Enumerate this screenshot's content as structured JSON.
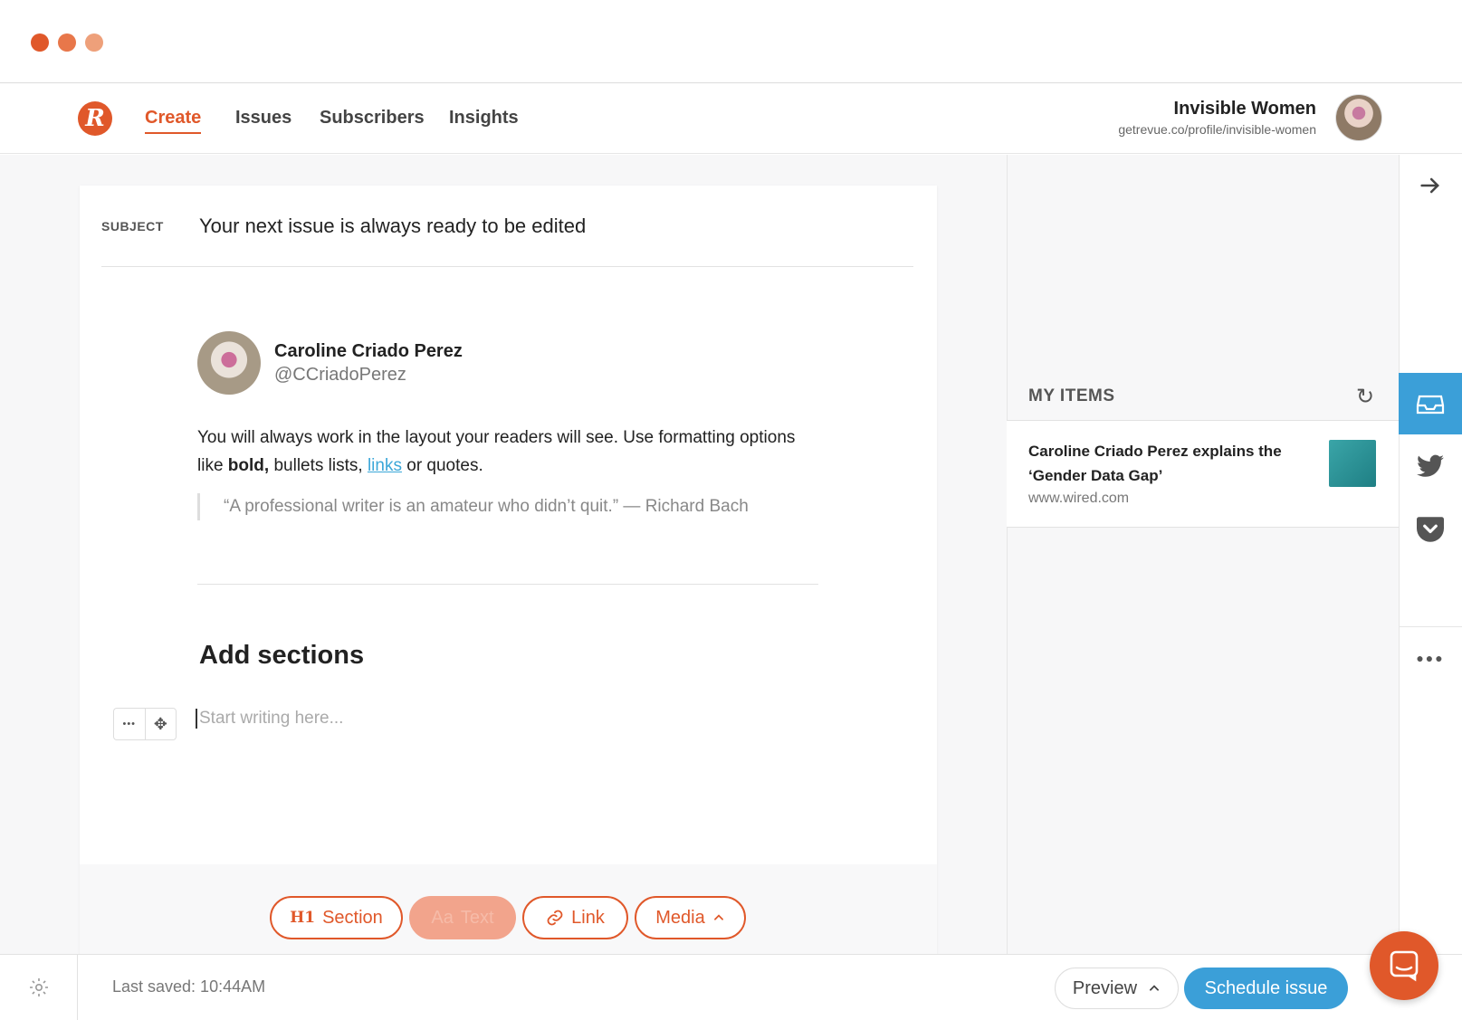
{
  "nav": {
    "logo_letter": "R",
    "links": [
      "Create",
      "Issues",
      "Subscribers",
      "Insights"
    ],
    "active": "Create"
  },
  "profile": {
    "name": "Invisible Women",
    "url": "getrevue.co/profile/invisible-women"
  },
  "editor": {
    "subject_label": "SUBJECT",
    "subject_value": "Your next issue is always ready to be edited",
    "tweet": {
      "name": "Caroline Criado Perez",
      "handle": "@CCriadoPerez"
    },
    "body": {
      "part1": "You will always work in the layout your readers will see. Use formatting options like ",
      "bold": "bold,",
      "part2": " bullets lists, ",
      "link": "links",
      "part3": " or quotes."
    },
    "quote": "“A professional writer is an amateur who didn’t quit.” — Richard Bach",
    "section_heading": "Add sections",
    "placeholder": "Start writing here...",
    "handle_more": "•••",
    "handle_move": "✥"
  },
  "toolbar": {
    "section_prefix": "H1",
    "section_label": "Section",
    "text_prefix": "Aa",
    "text_label": "Text",
    "link_label": "Link",
    "media_label": "Media"
  },
  "status": {
    "last_saved": "Last saved: 10:44AM",
    "preview_label": "Preview",
    "schedule_label": "Schedule issue"
  },
  "right_panel": {
    "title": "MY ITEMS",
    "items": [
      {
        "title": "Caroline Criado Perez explains the ‘Gender Data Gap’",
        "domain": "www.wired.com"
      }
    ]
  },
  "colors": {
    "accent": "#e0582a",
    "blue": "#3b9fd8"
  }
}
